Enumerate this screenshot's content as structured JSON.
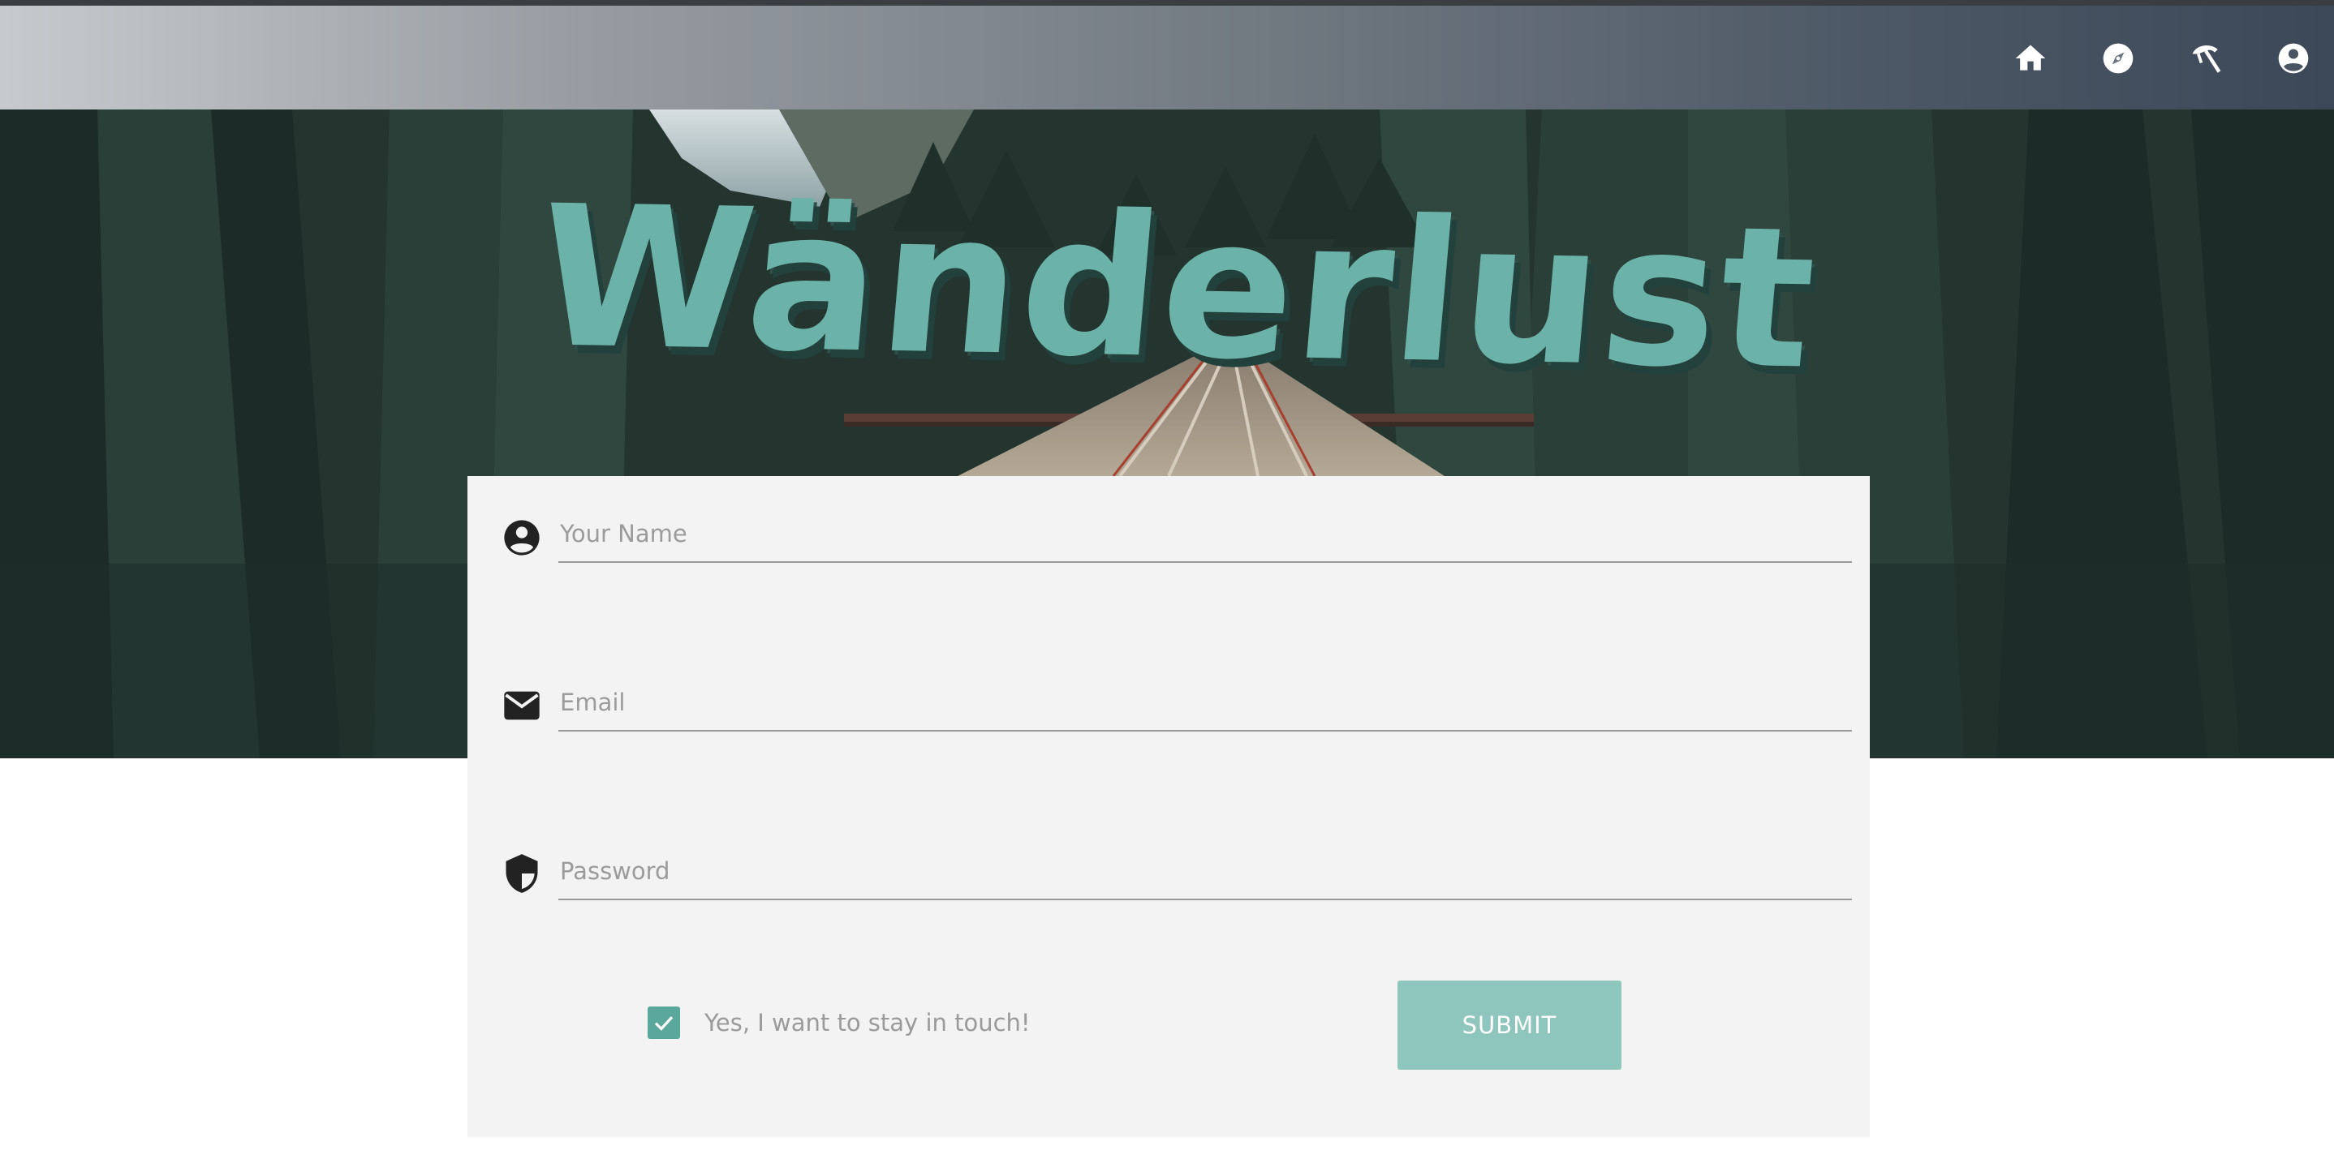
{
  "navbar": {
    "icons": [
      "home-icon",
      "compass-icon",
      "beach-umbrella-icon",
      "account-circle-icon"
    ],
    "background_gradient": [
      "#c7cacd",
      "#3c4858"
    ]
  },
  "hero": {
    "title": "Wänderlust",
    "title_color": "#6bb3a8"
  },
  "form": {
    "name_placeholder": "Your Name",
    "email_placeholder": "Email",
    "password_placeholder": "Password",
    "name_icon": "account-circle-icon",
    "email_icon": "mail-icon",
    "password_icon": "shield-icon",
    "stay_in_touch_label": "Yes, I want to stay in touch!",
    "stay_in_touch_checked": true,
    "submit_label": "SUBMIT",
    "accent_color": "#5aa79c",
    "submit_color": "#8ec5bd"
  }
}
